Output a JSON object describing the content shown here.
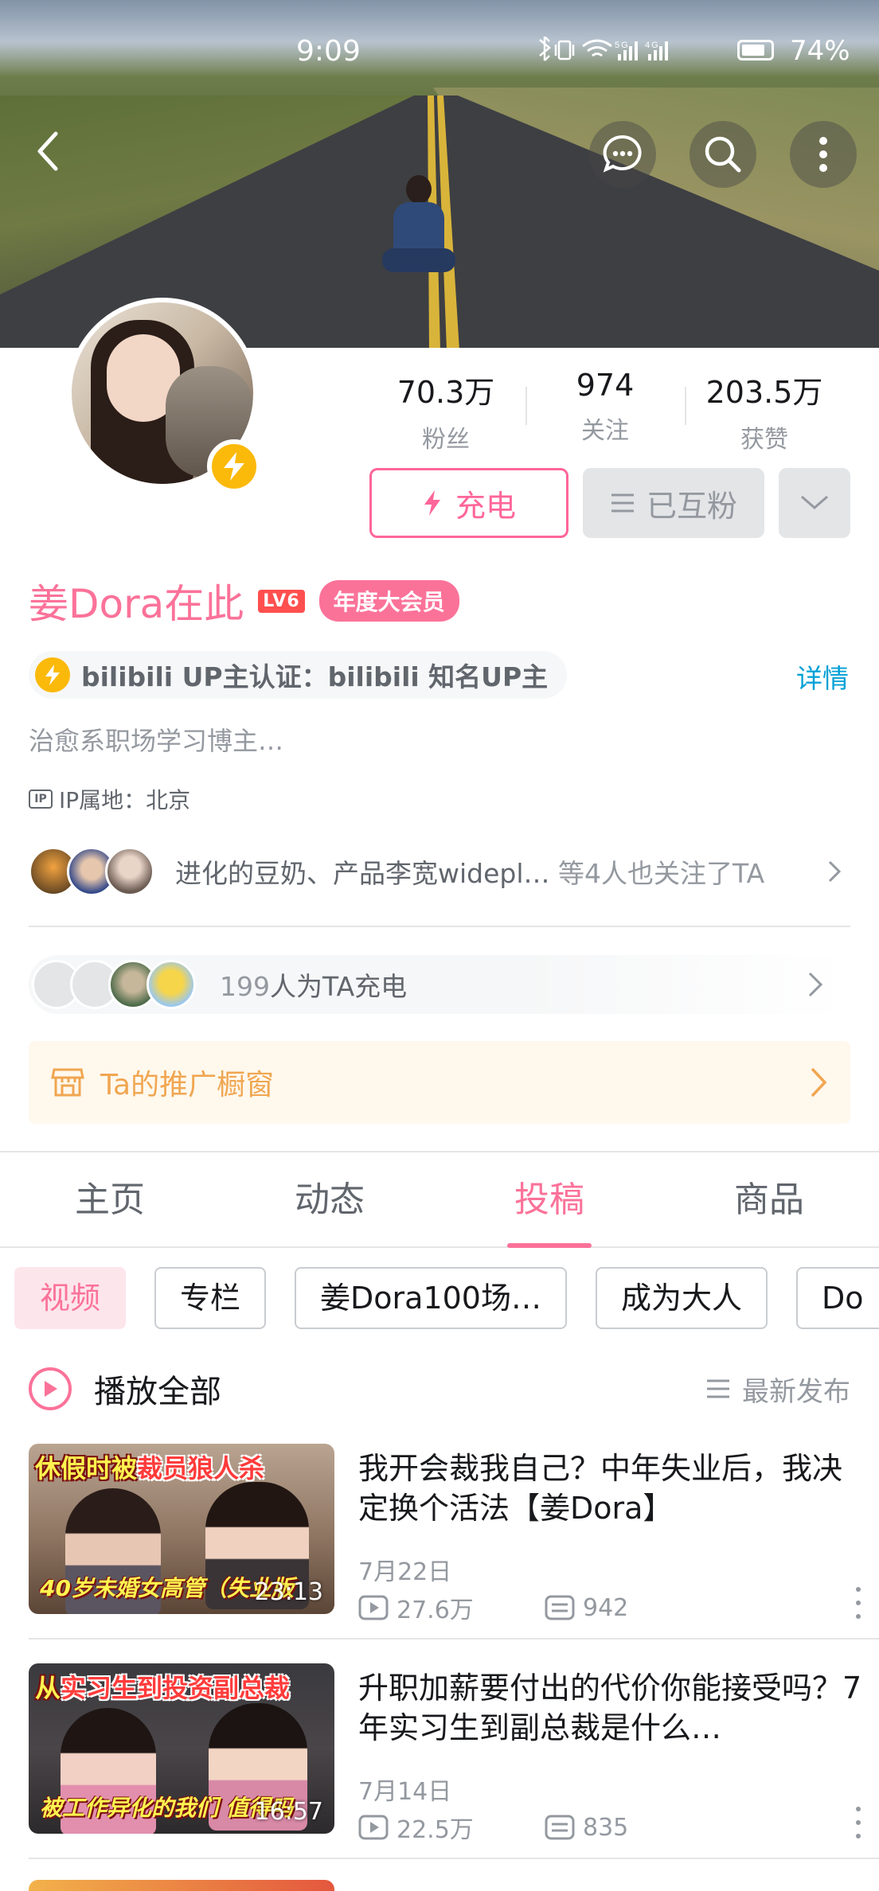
{
  "status_bar": {
    "time": "9:09",
    "signal_text": "5G 4G",
    "battery": "74%"
  },
  "header": {
    "icons": [
      "back-icon",
      "message-icon",
      "search-icon",
      "more-vertical-icon"
    ]
  },
  "profile": {
    "stats": [
      {
        "value": "70.3万",
        "label": "粉丝"
      },
      {
        "value": "974",
        "label": "关注"
      },
      {
        "value": "203.5万",
        "label": "获赞"
      }
    ],
    "charge_button": "充电",
    "mutual_button": "已互粉",
    "name": "姜Dora在此",
    "level": "LV6",
    "vip_badge": "年度大会员",
    "verification": "bilibili UP主认证：bilibili 知名UP主",
    "verification_detail": "详情",
    "bio": "治愈系职场学习博主…",
    "ip_location": "IP属地：北京",
    "mutual_follow_text": "进化的豆奶、产品李宽widepl…",
    "mutual_follow_suffix": "等4人也关注了TA",
    "charge_count": "199",
    "charge_text": "人为TA充电",
    "shop_window": "Ta的推广橱窗"
  },
  "tabs": [
    {
      "label": "主页",
      "active": false
    },
    {
      "label": "动态",
      "active": false
    },
    {
      "label": "投稿",
      "active": true
    },
    {
      "label": "商品",
      "active": false
    }
  ],
  "filter_chips": [
    {
      "label": "视频",
      "active": true
    },
    {
      "label": "专栏",
      "active": false
    },
    {
      "label": "姜Dora100场…",
      "active": false
    },
    {
      "label": "成为大人",
      "active": false
    },
    {
      "label": "Do",
      "active": false
    }
  ],
  "play_all": "播放全部",
  "sort_label": "最新发布",
  "videos": [
    {
      "thumb_caption_a": "休假时被",
      "thumb_caption_b": "裁员狼人杀",
      "thumb_bottom": "40岁未婚女高管（失业版",
      "duration": "23:13",
      "title": "我开会裁我自己？中年失业后，我决定换个活法【姜Dora】",
      "date": "7月22日",
      "views": "27.6万",
      "comments": "942"
    },
    {
      "thumb_caption_a": "从",
      "thumb_caption_b": "实习生到投资副总裁",
      "thumb_bottom": "被工作异化的我们 值得吗",
      "duration": "16:57",
      "title": "升职加薪要付出的代价你能接受吗？7年实习生到副总裁是什么…",
      "date": "7月14日",
      "views": "22.5万",
      "comments": "835"
    }
  ],
  "colors": {
    "accent_pink": "#fb7299",
    "link_blue": "#00a1d6",
    "gold": "#fbb90a",
    "shop_orange": "#f0a651"
  }
}
